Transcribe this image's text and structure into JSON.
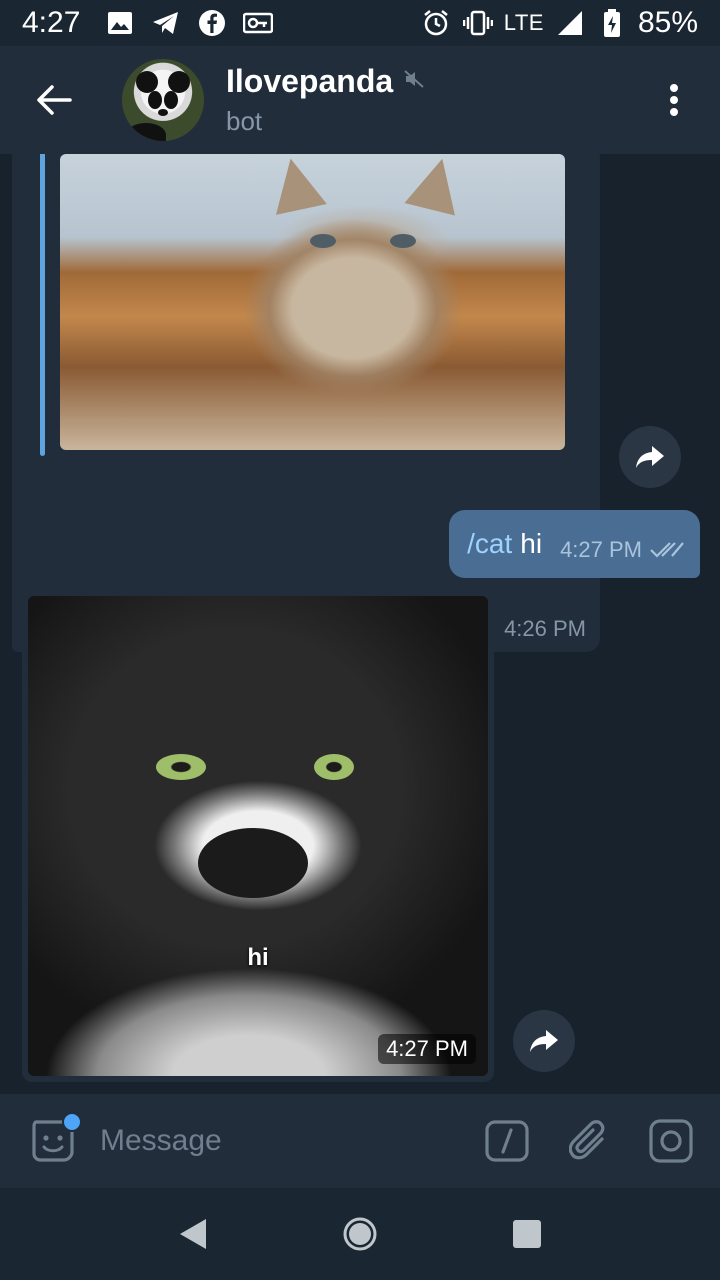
{
  "status_bar": {
    "time": "4:27",
    "network": "LTE",
    "battery": "85%",
    "left_icons": [
      "image-icon",
      "telegram-icon",
      "facebook-icon",
      "vpn-key-icon"
    ],
    "right_icons": [
      "alarm-icon",
      "vibrate-icon",
      "signal-icon",
      "battery-charging-icon"
    ]
  },
  "header": {
    "title": "Ilovepanda",
    "subtitle": "bot",
    "muted": true
  },
  "messages": [
    {
      "type": "incoming-photo-reply",
      "time": "4:26 PM"
    },
    {
      "type": "outgoing-text",
      "command": "/cat",
      "text": "hi",
      "time": "4:27 PM",
      "status": "read"
    },
    {
      "type": "incoming-photo",
      "caption": "hi",
      "time": "4:27 PM"
    }
  ],
  "input": {
    "placeholder": "Message"
  },
  "colors": {
    "background": "#18222d",
    "header": "#212d3b",
    "outgoing_bubble": "#4a6d94",
    "accent": "#5ea5e0",
    "badge": "#4ea4f6"
  }
}
